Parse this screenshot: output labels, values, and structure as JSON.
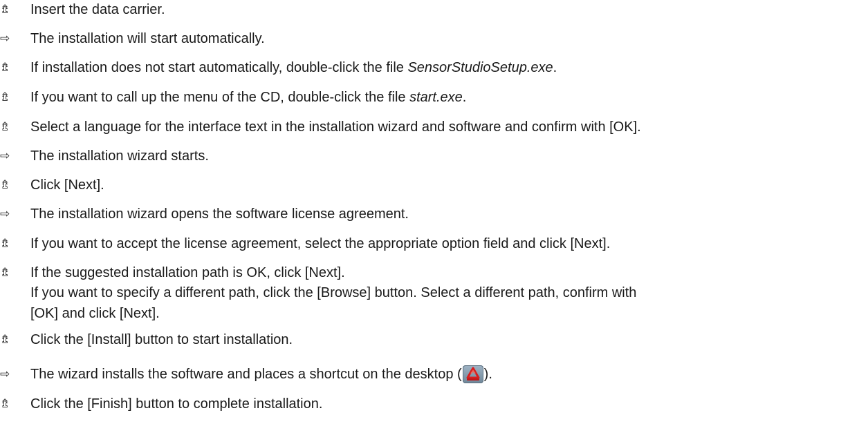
{
  "symbols": {
    "action": "⇯",
    "result": "⇨"
  },
  "steps": [
    {
      "kind": "action",
      "text": "Insert the data carrier."
    },
    {
      "kind": "result",
      "text": "The installation will start automatically."
    },
    {
      "kind": "action",
      "before": "If installation does not start automatically, double-click the file ",
      "em": "SensorStudioSetup.exe",
      "after": "."
    },
    {
      "kind": "action",
      "before": "If you want to call up the menu of the CD, double-click the file ",
      "em": "start.exe",
      "after": "."
    },
    {
      "kind": "action",
      "text": "Select a language for the interface text in the installation wizard and software and confirm with [OK]."
    },
    {
      "kind": "result",
      "text": "The installation wizard starts."
    },
    {
      "kind": "action",
      "text": "Click [Next]."
    },
    {
      "kind": "result",
      "text": "The installation wizard opens the software license agreement."
    },
    {
      "kind": "action",
      "text": "If you want to accept the license agreement, select the appropriate option field and click [Next]."
    },
    {
      "kind": "action",
      "line1": "If the suggested installation path is OK, click [Next].",
      "line2": "If you want to specify a different path, click the [Browse] button. Select a different path, confirm with",
      "line3": "[OK] and click [Next]."
    },
    {
      "kind": "action",
      "text": "Click the [Install] button to start installation."
    },
    {
      "kind": "result",
      "before": "The wizard installs the software and places a shortcut on the desktop (",
      "icon": "sensor-studio-shortcut-icon",
      "after": ")."
    },
    {
      "kind": "action",
      "text": "Click the [Finish] button to complete installation."
    }
  ]
}
